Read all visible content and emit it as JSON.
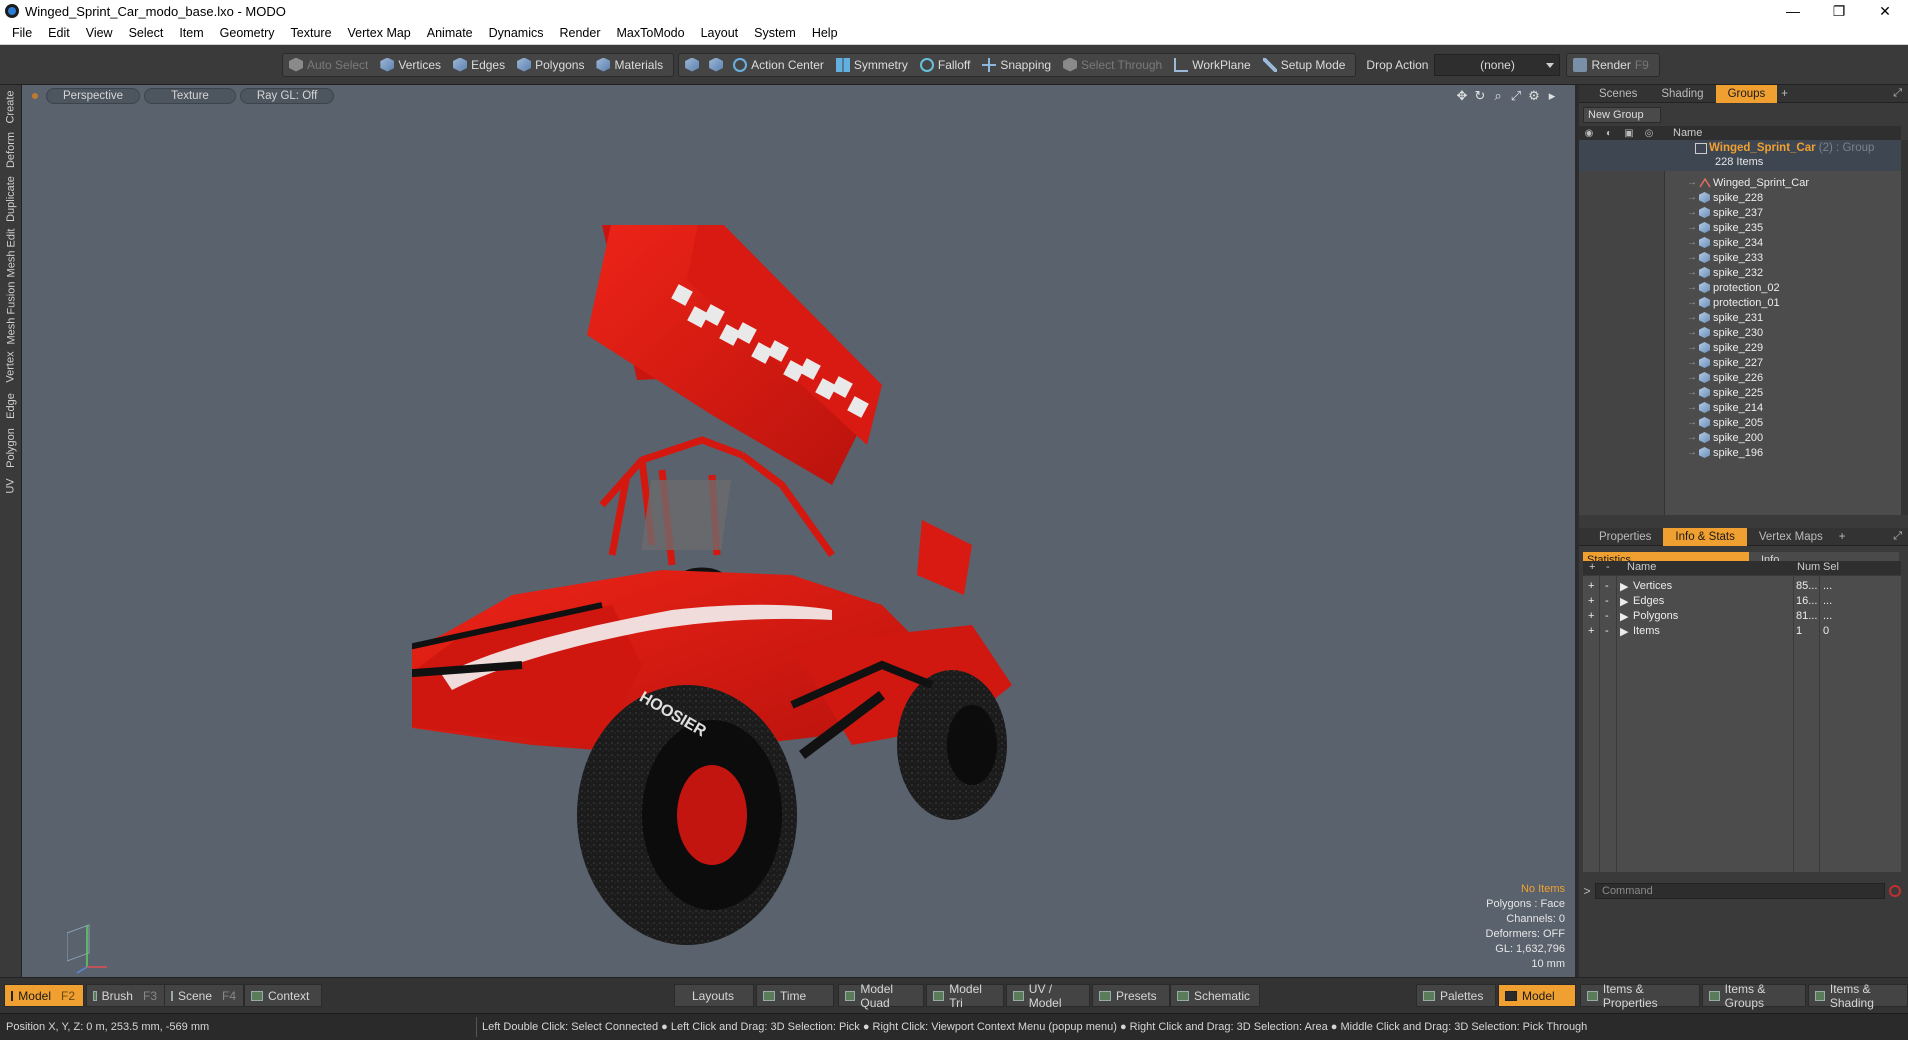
{
  "window": {
    "title": "Winged_Sprint_Car_modo_base.lxo - MODO",
    "controls": [
      "—",
      "❐",
      "✕"
    ]
  },
  "menu": [
    "File",
    "Edit",
    "View",
    "Select",
    "Item",
    "Geometry",
    "Texture",
    "Vertex Map",
    "Animate",
    "Dynamics",
    "Render",
    "MaxToModo",
    "Layout",
    "System",
    "Help"
  ],
  "toolbar": {
    "auto_select": "Auto Select",
    "vertices": "Vertices",
    "edges": "Edges",
    "polygons": "Polygons",
    "materials": "Materials",
    "action_center": "Action Center",
    "symmetry": "Symmetry",
    "falloff": "Falloff",
    "snapping": "Snapping",
    "select_through": "Select Through",
    "workplane": "WorkPlane",
    "setup_mode": "Setup Mode",
    "drop_action_label": "Drop Action",
    "drop_action_value": "(none)",
    "render": "Render",
    "render_key": "F9"
  },
  "left_tabs": [
    "Create",
    "Deform",
    "Duplicate",
    "Mesh Edit",
    "Mesh Fusion",
    "Vertex",
    "Edge",
    "Polygon",
    "UV"
  ],
  "viewport": {
    "view": "Perspective",
    "shading": "Texture",
    "raygl": "Ray GL: Off",
    "tools": [
      "✥",
      "↻",
      "⌕",
      "⤢",
      "⚙",
      "▸"
    ],
    "stats": {
      "selection": "No Items",
      "polygons": "Polygons : Face",
      "channels": "Channels: 0",
      "deformers": "Deformers: OFF",
      "gl": "GL: 1,632,796",
      "unit": "10 mm"
    },
    "car": {
      "tire_text": "HOOSIER",
      "colors": {
        "body": "#e01a14",
        "dark": "#141414",
        "checker": "#e9e9e9",
        "viewport_bg": "#59626d"
      }
    }
  },
  "groups_panel": {
    "tabs": [
      "Scenes",
      "Shading",
      "Groups"
    ],
    "active_tab": "Groups",
    "new_group": "New Group",
    "name_header": "Name",
    "group": {
      "name": "Winged_Sprint_Car",
      "sub": " (2) : Group",
      "count": "228 Items"
    },
    "items": [
      "Winged_Sprint_Car",
      "spike_228",
      "spike_237",
      "spike_235",
      "spike_234",
      "spike_233",
      "spike_232",
      "protection_02",
      "protection_01",
      "spike_231",
      "spike_230",
      "spike_229",
      "spike_227",
      "spike_226",
      "spike_225",
      "spike_214",
      "spike_205",
      "spike_200",
      "spike_196"
    ]
  },
  "info_panel": {
    "tabs": [
      "Properties",
      "Info & Stats",
      "Vertex Maps"
    ],
    "active_tab": "Info & Stats",
    "subtabs": [
      "Statistics",
      "Info"
    ],
    "headers": {
      "plus": "+",
      "minus": "-",
      "name": "Name",
      "num": "Num",
      "sel": "Sel"
    },
    "rows": [
      {
        "name": "Vertices",
        "num": "85...",
        "sel": "..."
      },
      {
        "name": "Edges",
        "num": "16...",
        "sel": "..."
      },
      {
        "name": "Polygons",
        "num": "81...",
        "sel": "..."
      },
      {
        "name": "Items",
        "num": "1",
        "sel": "0"
      }
    ],
    "command_placeholder": "Command"
  },
  "bottom_bar": {
    "model": "Model",
    "model_key": "F2",
    "brush": "Brush",
    "brush_key": "F3",
    "scene": "Scene",
    "scene_key": "F4",
    "context": "Context",
    "layouts": "Layouts",
    "time": "Time",
    "model_quad": "Model Quad",
    "model_tri": "Model Tri",
    "uv_model": "UV / Model",
    "presets": "Presets",
    "schematic": "Schematic",
    "palettes": "Palettes",
    "model_right": "Model",
    "items_properties": "Items & Properties",
    "items_groups": "Items & Groups",
    "items_shading": "Items & Shading"
  },
  "status_bar": {
    "position": "Position X, Y, Z:   0 m, 253.5 mm, -569 mm",
    "hint": "Left Double Click: Select Connected ● Left Click and Drag: 3D Selection: Pick ● Right Click: Viewport Context Menu (popup menu) ● Right Click and Drag: 3D Selection: Area ● Middle Click and Drag: 3D Selection: Pick Through"
  }
}
